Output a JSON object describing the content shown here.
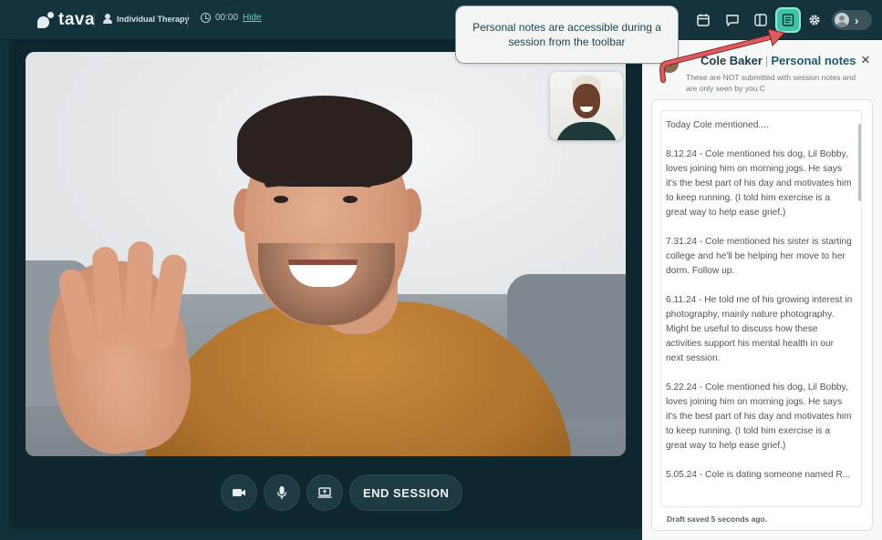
{
  "brand": {
    "name": "tava"
  },
  "session": {
    "type_label": "Individual Therapy",
    "timer": "00:00",
    "hide_label": "Hide"
  },
  "toolbar": {
    "tools": [
      {
        "name": "calendar-icon"
      },
      {
        "name": "chat-icon"
      },
      {
        "name": "sidebar-icon"
      },
      {
        "name": "notes-icon",
        "active": true
      },
      {
        "name": "gear-icon"
      }
    ],
    "profile_chevron": "›"
  },
  "callout": {
    "text": "Personal notes are accessible during a session from the toolbar"
  },
  "controls": {
    "end_session_label": "END SESSION"
  },
  "notes_panel": {
    "client_name": "Cole Baker",
    "divider": "|",
    "title": "Personal notes",
    "subtitle": "These are NOT submitted with session notes and are only seen by you.C",
    "close_glyph": "×",
    "entries": [
      "Today Cole mentioned....",
      "8.12.24 - Cole mentioned his dog, Lil Bobby, loves joining him on morning jogs. He says it's the best part of his day and motivates him to keep running. (I told him exercise is a great way to help ease grief.)",
      "7.31.24 - Cole mentioned his sister is starting college and he'll be helping her move to her dorm. Follow up.",
      "6.11.24 - He told me of his growing interest in photography, mainly nature photography. Might be useful to discuss how these activities support his mental health in our next session.",
      "5.22.24 - Cole mentioned his dog, Lil Bobby, loves joining him on morning jogs. He says it's the best part of his day and motivates him to keep running. (I told him exercise is a great way to help ease grief.)",
      "5.05.24 - Cole is dating someone named R..."
    ],
    "draft_status": "Draft saved 5 seconds ago."
  },
  "colors": {
    "accent": "#3ec3a6",
    "topbar": "#14333c",
    "stage": "#0e262d",
    "callout_arrow": "#e05a5a"
  }
}
